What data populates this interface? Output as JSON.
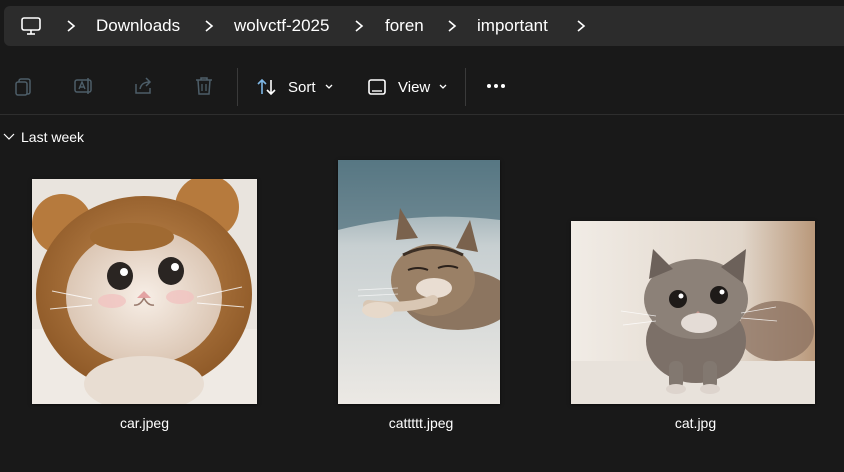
{
  "breadcrumb": {
    "root_icon": "computer-monitor-icon",
    "items": [
      "Downloads",
      "wolvctf-2025",
      "foren",
      "important"
    ]
  },
  "toolbar": {
    "icons": [
      "copy-icon",
      "rename-icon",
      "share-icon",
      "delete-icon"
    ],
    "sort_label": "Sort",
    "view_label": "View",
    "more_icon": "more-icon"
  },
  "group": {
    "label": "Last week"
  },
  "files": [
    {
      "name": "car.jpeg",
      "thumb": "kitten in brown bear hood"
    },
    {
      "name": "cattttt.jpeg",
      "thumb": "sleeping tabby kitten"
    },
    {
      "name": "cat.jpg",
      "thumb": "tabby kitten standing"
    }
  ],
  "colors": {
    "background": "#191919",
    "addressbar": "#2c2c2c",
    "text": "#ffffff",
    "muted_icon": "#5b6b75"
  }
}
